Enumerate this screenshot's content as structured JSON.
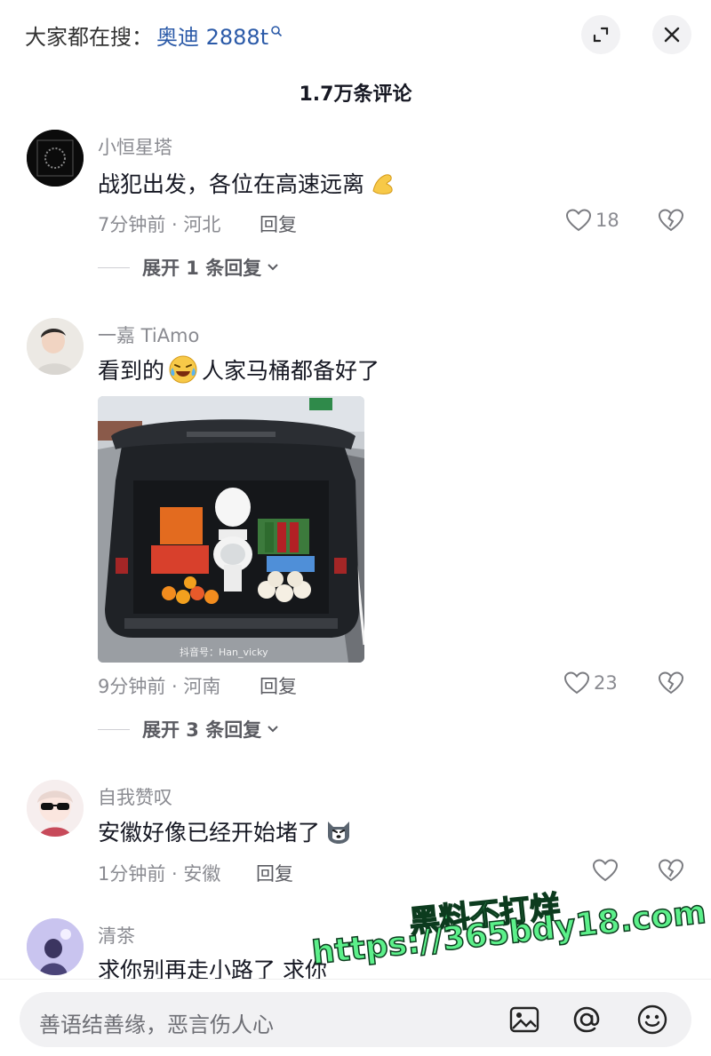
{
  "header": {
    "search_prefix": "大家都在搜：",
    "search_keyword": "奥迪 2888t",
    "comment_count": "1.7万条评论",
    "icons": [
      "expand-icon",
      "close-icon"
    ]
  },
  "comments": [
    {
      "username": "小恒星塔",
      "text": "战犯出发，各位在高速远离",
      "emoji": "flexed-arm-emoji",
      "time_location": "7分钟前 · 河北",
      "reply_label": "回复",
      "likes": "18",
      "expand_replies": "展开 1 条回复"
    },
    {
      "username": "一嘉 TiAmo",
      "text_before": "看到的",
      "text_after": " 人家马桶都备好了",
      "emoji": "laughing-crying-emoji",
      "photo_watermark": "抖音号：Han_vicky",
      "time_location": "9分钟前 · 河南",
      "reply_label": "回复",
      "likes": "23",
      "expand_replies": "展开 3 条回复"
    },
    {
      "username": "自我赞叹",
      "text": "安徽好像已经开始堵了",
      "emoji": "husky-dog-emoji",
      "time_location": "1分钟前 · 安徽",
      "reply_label": "回复",
      "likes": ""
    },
    {
      "username": "清茶",
      "text": "求你别再走小路了 求你"
    }
  ],
  "input_bar": {
    "placeholder": "善语结善缘，恶言伤人心",
    "icons": [
      "image-icon",
      "at-icon",
      "emoji-icon"
    ]
  },
  "overlay_watermark": {
    "line1": "黑料不打烊",
    "line2": "https://365bdy18.com"
  },
  "colors": {
    "accent_blue": "#2b5aa8",
    "text_primary": "#161823",
    "text_secondary": "#8a8b91",
    "watermark_green": "#5cf08a"
  }
}
